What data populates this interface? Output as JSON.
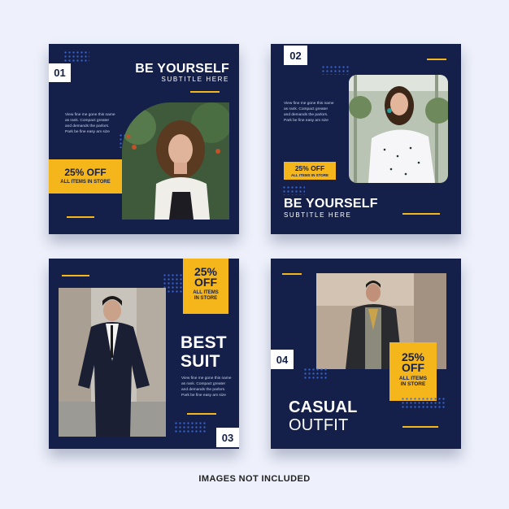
{
  "card1": {
    "number": "01",
    "title": "BE YOURSELF",
    "subtitle": "SUBTITLE HERE",
    "body": [
      "View fine me gone this name",
      "as rank. Compact greater",
      "and demands the parlors.",
      "Park be fine easy am size"
    ],
    "badge_main": "25% OFF",
    "badge_sub": "ALL ITEMS IN STORE"
  },
  "card2": {
    "number": "02",
    "title": "BE YOURSELF",
    "subtitle": "SUBTITLE HERE",
    "body": [
      "View fine me gone this name",
      "as rank. Compact greater",
      "and demands the parlors.",
      "Park be fine easy am size"
    ],
    "badge_main": "25% OFF",
    "badge_sub": "ALL ITEMS IN STORE"
  },
  "card3": {
    "number": "03",
    "title_line1": "BEST",
    "title_line2": "SUIT",
    "body": [
      "View fine me gone this name",
      "as rank. Compact greater",
      "and demands the parlors.",
      "Park be fine easy am size"
    ],
    "badge_line1": "25%",
    "badge_line2": "OFF",
    "badge_line3": "ALL ITEMS",
    "badge_line4": "IN STORE"
  },
  "card4": {
    "number": "04",
    "title_line1": "CASUAL",
    "title_line2": "OUTFIT",
    "badge_line1": "25%",
    "badge_line2": "OFF",
    "badge_line3": "ALL ITEMS",
    "badge_line4": "IN STORE"
  },
  "footer": "IMAGES NOT INCLUDED",
  "colors": {
    "navy": "#14204a",
    "accent": "#f5b61b",
    "dots": "#3a66d6"
  }
}
